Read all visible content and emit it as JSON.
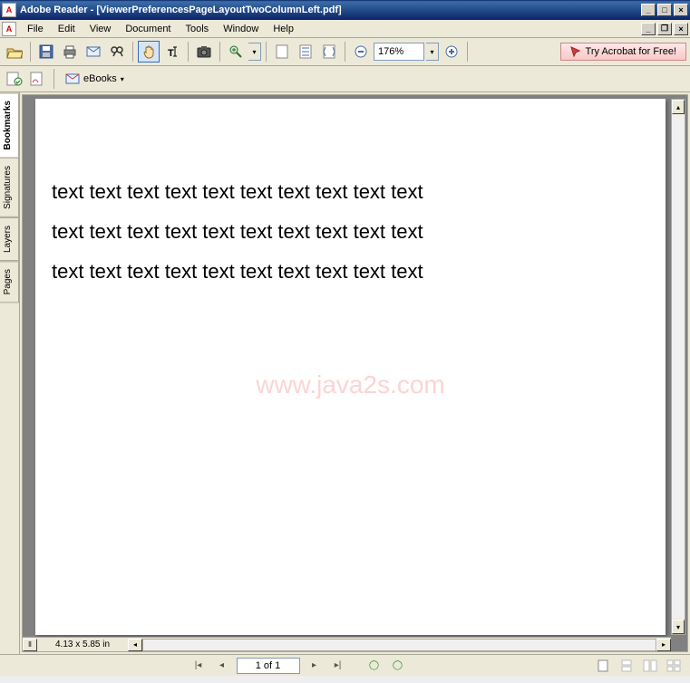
{
  "title": {
    "app": "Adobe Reader",
    "doc": "[ViewerPreferencesPageLayoutTwoColumnLeft.pdf]"
  },
  "menu": {
    "file": "File",
    "edit": "Edit",
    "view": "View",
    "document": "Document",
    "tools": "Tools",
    "window": "Window",
    "help": "Help"
  },
  "toolbar": {
    "zoom": "176%",
    "ebooks": "eBooks"
  },
  "promo": {
    "label": "Try Acrobat for Free!"
  },
  "nav": {
    "bookmarks": "Bookmarks",
    "signatures": "Signatures",
    "layers": "Layers",
    "pages": "Pages"
  },
  "doc": {
    "lines": [
      "text text text text text text text text text text",
      "text text text text text text text text text text",
      "text text text text text text text text text text"
    ],
    "watermark": "www.java2s.com"
  },
  "status": {
    "dimensions": "4.13 x 5.85 in",
    "page": "1 of 1"
  }
}
